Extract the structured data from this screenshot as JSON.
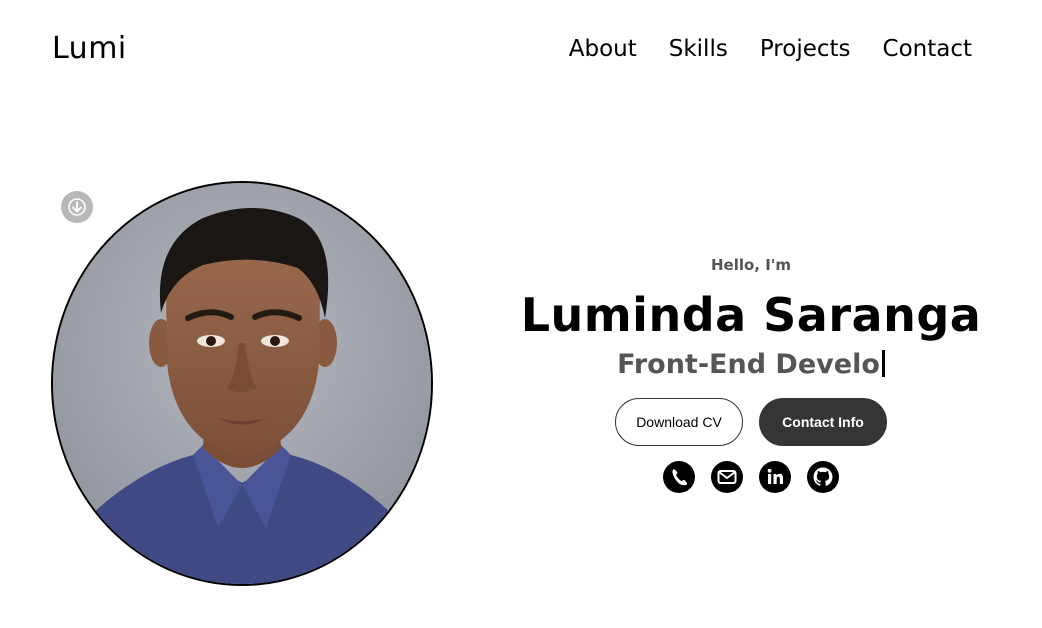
{
  "header": {
    "logo": "Lumi",
    "nav": [
      "About",
      "Skills",
      "Projects",
      "Contact"
    ]
  },
  "hero": {
    "greeting": "Hello, I'm",
    "name": "Luminda Saranga",
    "role_typed": "Front-End Develo",
    "buttons": {
      "download_cv": "Download CV",
      "contact_info": "Contact Info"
    },
    "socials": [
      "phone-icon",
      "email-icon",
      "linkedin-icon",
      "github-icon"
    ]
  },
  "colors": {
    "text": "#000000",
    "muted": "#555555",
    "button_dark": "#353535",
    "scroll_button": "#b8b8b8"
  },
  "icons": {
    "scroll": "arrow-down-icon"
  }
}
